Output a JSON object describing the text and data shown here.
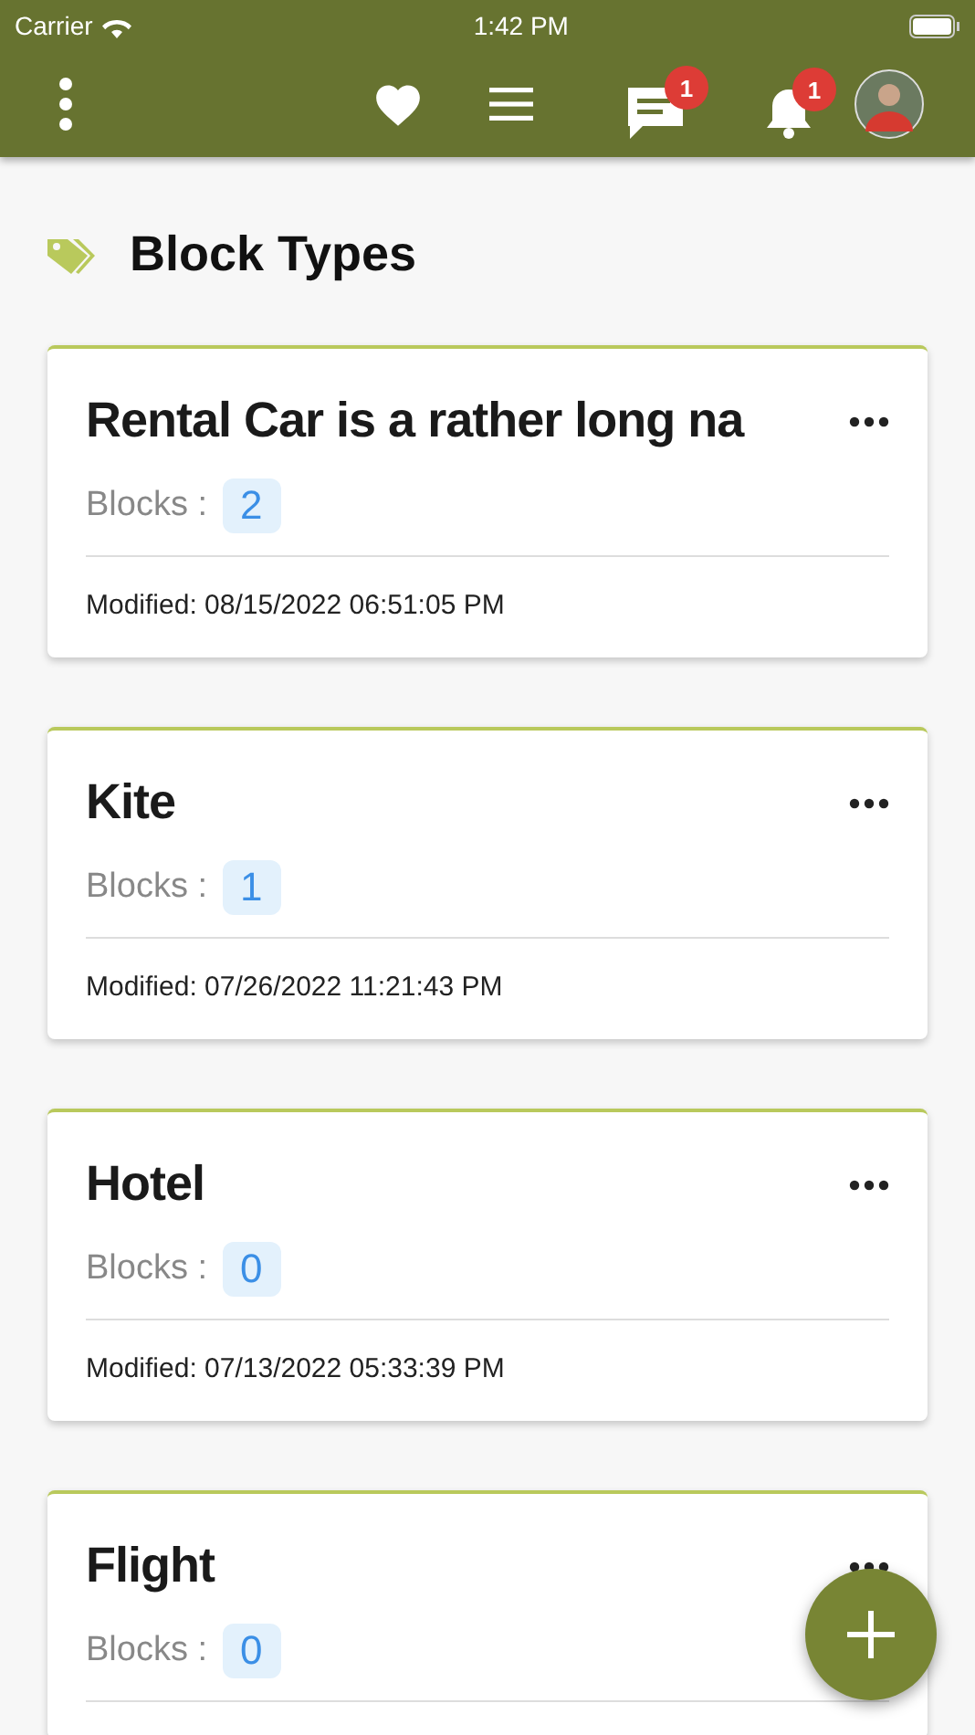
{
  "status_bar": {
    "carrier": "Carrier",
    "time": "1:42 PM"
  },
  "app_bar": {
    "messages_badge": "1",
    "notifications_badge": "1"
  },
  "page": {
    "title": "Block Types"
  },
  "cards": [
    {
      "title": "Rental Car is a rather long na",
      "count_label": "Blocks :",
      "count": "2",
      "modified": "Modified: 08/15/2022 06:51:05 PM"
    },
    {
      "title": "Kite",
      "count_label": "Blocks :",
      "count": "1",
      "modified": "Modified: 07/26/2022 11:21:43 PM"
    },
    {
      "title": "Hotel",
      "count_label": "Blocks :",
      "count": "0",
      "modified": "Modified: 07/13/2022 05:33:39 PM"
    },
    {
      "title": "Flight",
      "count_label": "Blocks :",
      "count": "0"
    }
  ]
}
